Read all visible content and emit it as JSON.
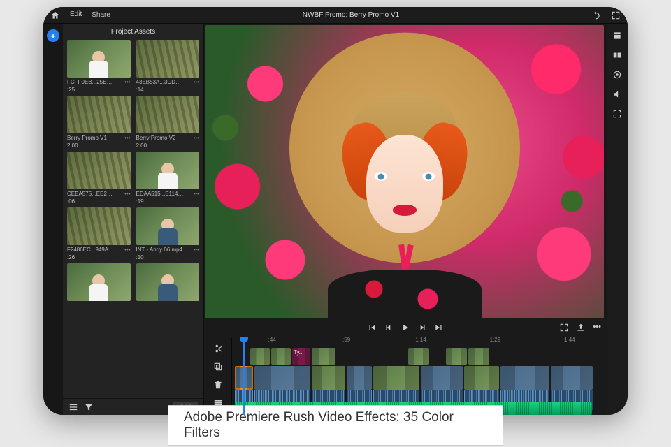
{
  "topbar": {
    "tabs": [
      "Edit",
      "Share"
    ],
    "title": "NWBF Promo: Berry Promo V1"
  },
  "assets_header": "Project Assets",
  "add_label": "Add",
  "assets": [
    {
      "fn": "FCFF0EB...25E4.mp4",
      "dur": ":25"
    },
    {
      "fn": "43EB53A...3CD6.mp4",
      "dur": ":14"
    },
    {
      "fn": "Berry Promo V1",
      "dur": "2:00"
    },
    {
      "fn": "Berry Promo V2",
      "dur": "2:00"
    },
    {
      "fn": "CEBA575...EE2C.mp4",
      "dur": ":06"
    },
    {
      "fn": "EDAA515...E114.mp4",
      "dur": ":19"
    },
    {
      "fn": "F2486EC...949A.mp4",
      "dur": ":26"
    },
    {
      "fn": "INT - Andy 06.mp4",
      "dur": ":10"
    }
  ],
  "ruler": [
    ":44",
    ":59",
    "1:14",
    "1:29",
    "1:44"
  ],
  "title_clip": "Ty...",
  "caption": "Adobe Premiere Rush Video Effects: 35 Color Filters"
}
